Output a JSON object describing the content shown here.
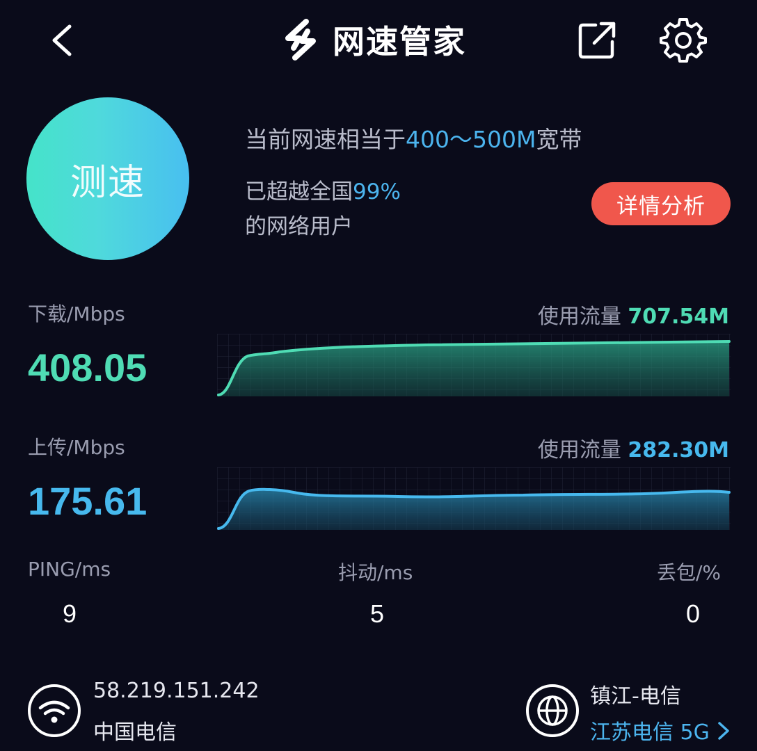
{
  "header": {
    "title": "网速管家"
  },
  "test_button": {
    "label": "测速"
  },
  "summary": {
    "line1_prefix": "当前网速相当于",
    "line1_value": "400～500M",
    "line1_suffix": "宽带",
    "line2_prefix": "已超越全国",
    "line2_value": "99%",
    "line3": "的网络用户",
    "detail_button": "详情分析"
  },
  "download": {
    "label": "下载/Mbps",
    "value": "408.05",
    "traffic_label": "使用流量",
    "traffic_value": "707.54M",
    "color": "#4fdcb4"
  },
  "upload": {
    "label": "上传/Mbps",
    "value": "175.61",
    "traffic_label": "使用流量",
    "traffic_value": "282.30M",
    "color": "#47b9ee"
  },
  "stats": {
    "ping_label": "PING/ms",
    "ping_value": "9",
    "jitter_label": "抖动/ms",
    "jitter_value": "5",
    "loss_label": "丢包/%",
    "loss_value": "0"
  },
  "network": {
    "ip": "58.219.151.242",
    "isp": "中国电信",
    "location": "镇江-电信",
    "network_type": "江苏电信 5G",
    "wifi_icon": "wifi-icon",
    "globe_icon": "globe-icon"
  },
  "colors": {
    "background": "#0a0b1a",
    "accent_blue": "#4cb4ee",
    "accent_green": "#4fdcb4",
    "detail_button": "#f0574c"
  }
}
